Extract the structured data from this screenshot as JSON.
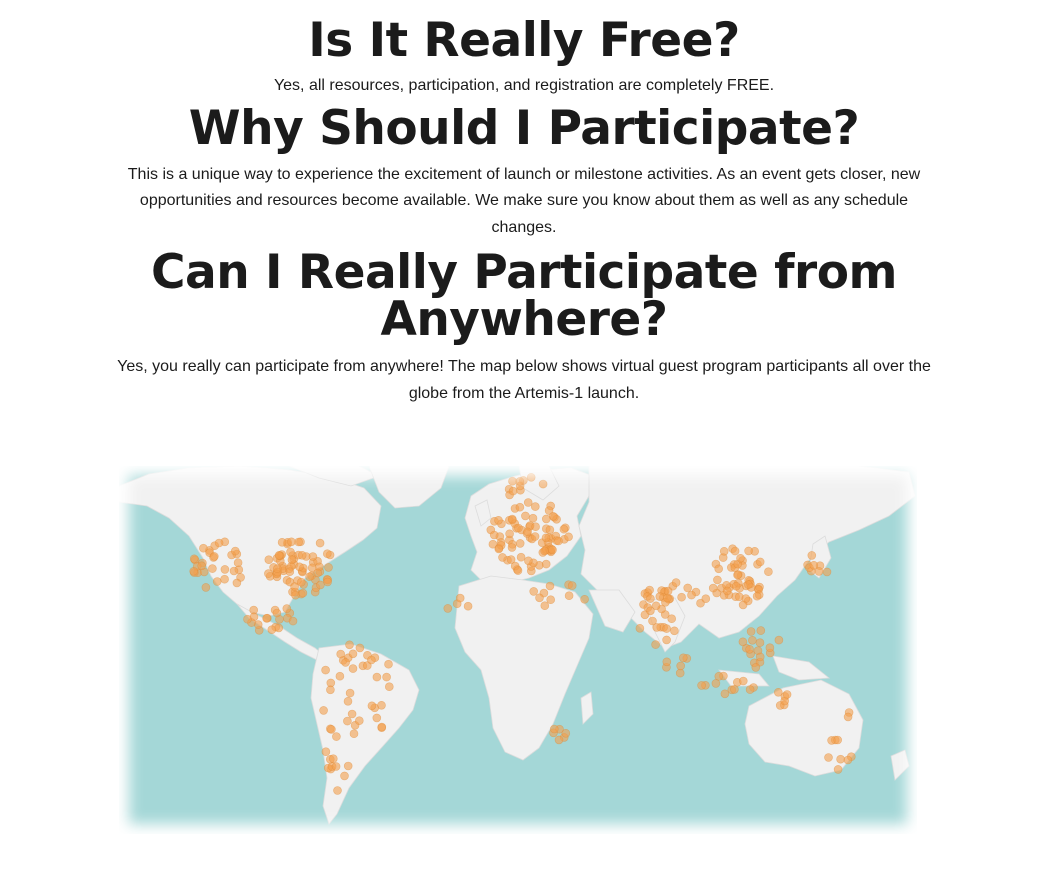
{
  "sections": [
    {
      "heading": "Is It Really Free?",
      "body": "Yes, all resources, participation, and registration are completely FREE."
    },
    {
      "heading": "Why Should I Participate?",
      "body": "This is a unique way to experience the excitement of launch or milestone activities. As an event gets closer, new opportunities and resources become available. We make sure you know about them as well as any schedule changes."
    },
    {
      "heading": "Can I Really Participate from Anywhere?",
      "body": "Yes, you really can participate from anywhere! The map below shows virtual guest program participants all over the globe from the Artemis-1 launch."
    }
  ],
  "map": {
    "ocean_color": "#a4d7d7",
    "land_color": "#f1f1f1",
    "marker_color": "#f3a04e"
  }
}
